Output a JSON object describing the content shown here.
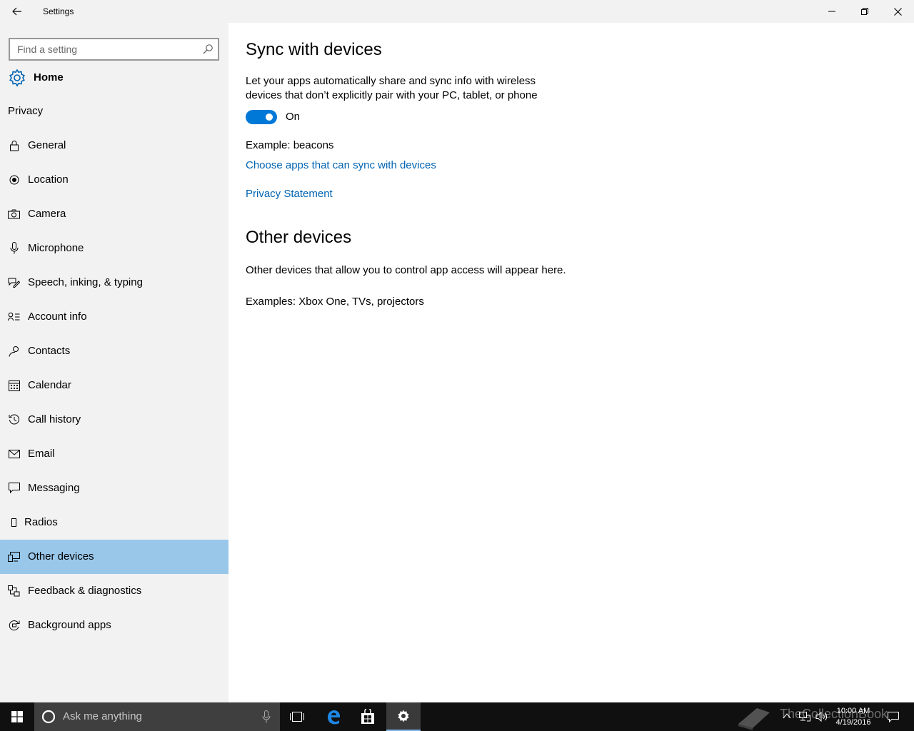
{
  "window": {
    "title": "Settings",
    "controls": [
      "minimize",
      "restore",
      "close"
    ]
  },
  "sidebar": {
    "search": {
      "placeholder": "Find a setting",
      "value": ""
    },
    "home_label": "Home",
    "section_label": "Privacy",
    "items": [
      {
        "label": "General",
        "icon": "lock-icon"
      },
      {
        "label": "Location",
        "icon": "location-icon"
      },
      {
        "label": "Camera",
        "icon": "camera-icon"
      },
      {
        "label": "Microphone",
        "icon": "microphone-icon"
      },
      {
        "label": "Speech, inking, & typing",
        "icon": "speech-icon"
      },
      {
        "label": "Account info",
        "icon": "account-info-icon"
      },
      {
        "label": "Contacts",
        "icon": "contacts-icon"
      },
      {
        "label": "Calendar",
        "icon": "calendar-icon"
      },
      {
        "label": "Call history",
        "icon": "history-icon"
      },
      {
        "label": "Email",
        "icon": "email-icon"
      },
      {
        "label": "Messaging",
        "icon": "messaging-icon"
      },
      {
        "label": "Radios",
        "icon": "radios-icon"
      },
      {
        "label": "Other devices",
        "icon": "devices-icon",
        "selected": true
      },
      {
        "label": "Feedback & diagnostics",
        "icon": "feedback-icon"
      },
      {
        "label": "Background apps",
        "icon": "background-apps-icon"
      }
    ]
  },
  "content": {
    "sync_heading": "Sync with devices",
    "sync_description": "Let your apps automatically share and sync info with wireless devices that don’t explicitly pair with your PC, tablet, or phone",
    "toggle": {
      "state": "On",
      "on": true
    },
    "example": "Example: beacons",
    "link_choose_apps": "Choose apps that can sync with devices",
    "link_privacy": "Privacy Statement",
    "other_heading": "Other devices",
    "other_description": "Other devices that allow you to control app access will appear here.",
    "other_examples": "Examples: Xbox One, TVs, projectors"
  },
  "taskbar": {
    "search_placeholder": "Ask me anything",
    "time": "10:00 AM",
    "date": "4/19/2016",
    "watermark": "TheCollectionBook",
    "accent": "#7eb4ea"
  },
  "colors": {
    "accent": "#0078d7",
    "link": "#0063b1",
    "selected": "#99c7ea",
    "sidebar_bg": "#f2f2f2"
  }
}
